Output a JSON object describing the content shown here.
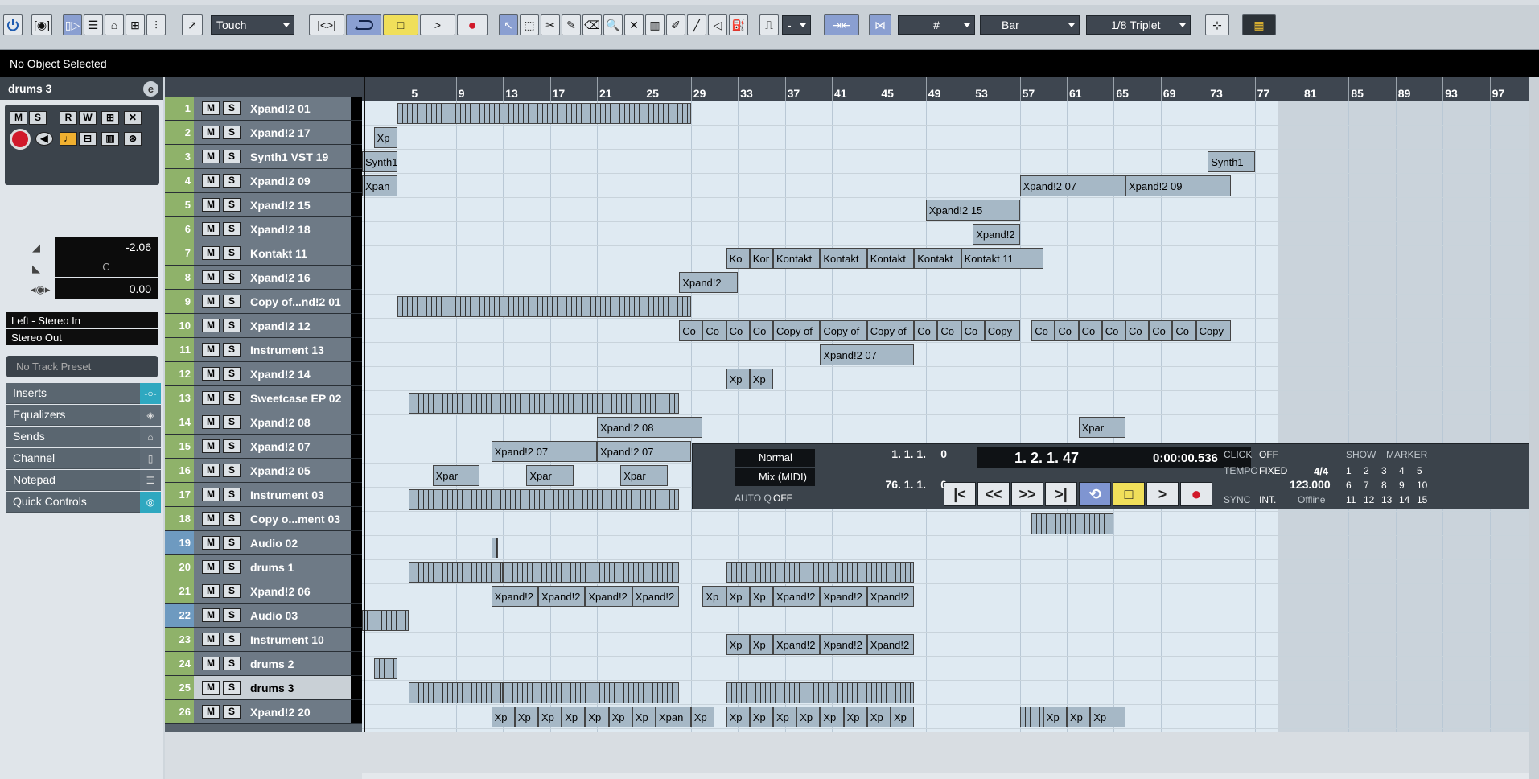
{
  "toolbar": {
    "automation_mode": "Touch",
    "grid_type": "Bar",
    "quantize": "1/8 Triplet",
    "nudge_value": "-"
  },
  "info_line": {
    "text": "No Object Selected"
  },
  "inspector": {
    "track_name": "drums 3",
    "edit_icon": "e",
    "volume": "-2.06",
    "pan": "C",
    "delay": "0.00",
    "input": "Left - Stereo In",
    "output": "Stereo Out",
    "preset": "No Track Preset",
    "sections": [
      "Inserts",
      "Equalizers",
      "Sends",
      "Channel",
      "Notepad",
      "Quick Controls"
    ]
  },
  "ruler": {
    "bars": [
      "5",
      "9",
      "13",
      "17",
      "21",
      "25",
      "29",
      "33",
      "37",
      "41",
      "45",
      "49",
      "53",
      "57",
      "61",
      "65",
      "69",
      "73",
      "77",
      "81",
      "85",
      "89",
      "93",
      "97"
    ]
  },
  "tracks": [
    {
      "num": "1",
      "name": "Xpand!2 01"
    },
    {
      "num": "2",
      "name": "Xpand!2 17"
    },
    {
      "num": "3",
      "name": "Synth1 VST 19"
    },
    {
      "num": "4",
      "name": "Xpand!2 09"
    },
    {
      "num": "5",
      "name": "Xpand!2 15"
    },
    {
      "num": "6",
      "name": "Xpand!2 18"
    },
    {
      "num": "7",
      "name": "Kontakt 11"
    },
    {
      "num": "8",
      "name": "Xpand!2 16"
    },
    {
      "num": "9",
      "name": "Copy of...nd!2 01"
    },
    {
      "num": "10",
      "name": "Xpand!2 12"
    },
    {
      "num": "11",
      "name": "Instrument 13"
    },
    {
      "num": "12",
      "name": "Xpand!2 14"
    },
    {
      "num": "13",
      "name": "Sweetcase EP 02"
    },
    {
      "num": "14",
      "name": "Xpand!2 08"
    },
    {
      "num": "15",
      "name": "Xpand!2 07"
    },
    {
      "num": "16",
      "name": "Xpand!2 05"
    },
    {
      "num": "17",
      "name": "Instrument 03"
    },
    {
      "num": "18",
      "name": "Copy o...ment 03"
    },
    {
      "num": "19",
      "name": "Audio 02"
    },
    {
      "num": "20",
      "name": "drums 1"
    },
    {
      "num": "21",
      "name": "Xpand!2 06"
    },
    {
      "num": "22",
      "name": "Audio 03"
    },
    {
      "num": "23",
      "name": "Instrument 10"
    },
    {
      "num": "24",
      "name": "drums 2"
    },
    {
      "num": "25",
      "name": "drums 3"
    },
    {
      "num": "26",
      "name": "Xpand!2 20"
    }
  ],
  "events": {
    "e0": "Xp",
    "e1": "Synth1",
    "e2": "Synth1",
    "e3": "Xpan",
    "e4": "Xpand!2 07",
    "e5": "Xpand!2 09",
    "e6": "Xpand!2 15",
    "e7": "Xpand!2",
    "e8": "Ko",
    "e9": "Kor",
    "e10": "Kontakt",
    "e11": "Kontakt",
    "e12": "Kontakt",
    "e13": "Kontakt",
    "e14": "Kontakt 11",
    "e15": "Xpand!2",
    "e16": "Co",
    "e17": "Co",
    "e18": "Co",
    "e19": "Co",
    "e20": "Copy of",
    "e21": "Copy of",
    "e22": "Copy of",
    "e23": "Co",
    "e24": "Co",
    "e25": "Co",
    "e26": "Copy",
    "e27": "Co",
    "e28": "Co",
    "e29": "Co",
    "e30": "Co",
    "e31": "Co",
    "e32": "Co",
    "e33": "Co",
    "e34": "Copy",
    "e35": "Xpand!2 07",
    "e36": "Xp",
    "e37": "Xp",
    "e38": "Xpand!2 08",
    "e39": "Xpar",
    "e40": "Xpand!2 07",
    "e41": "Xpand!2 07",
    "e42": "Xpar",
    "e43": "Xpar",
    "e44": "Xpar",
    "e45": "Xpand!2",
    "e46": "Xpand!2",
    "e47": "Xpand!2",
    "e48": "Xpand!2",
    "e49": "Xp",
    "e50": "Xp",
    "e51": "Xp",
    "e52": "Xpand!2",
    "e53": "Xpand!2",
    "e54": "Xpand!2",
    "e55": "Xp",
    "e56": "Xp",
    "e57": "Xpand!2",
    "e58": "Xpand!2",
    "e59": "Xpand!2",
    "e60": "Xp",
    "e61": "Xp",
    "e62": "Xp",
    "e63": "Xp",
    "e64": "Xp",
    "e65": "Xp",
    "e66": "Xp",
    "e67": "Xpan",
    "e68": "Xp",
    "e69": "Xp",
    "e70": "Xp",
    "e71": "Xp",
    "e72": "Xp",
    "e73": "Xp",
    "e74": "Xp",
    "e75": "Xp",
    "e76": "Xp",
    "e77": "Xp",
    "e78": "Xp",
    "e79": "Xp"
  },
  "transport": {
    "mode": "Normal",
    "mix": "Mix (MIDI)",
    "autoq_label": "AUTO Q",
    "autoq": "OFF",
    "left_locator": "1. 1. 1.",
    "left_sub": "0",
    "right_locator": "76. 1. 1.",
    "right_sub": "0",
    "position_bars": "1. 2. 1. 47",
    "position_time": "0:00:00.536",
    "click_label": "CLICK",
    "click": "OFF",
    "tempo_label": "TEMPO",
    "tempo_mode": "FIXED",
    "signature": "4/4",
    "tempo": "123.000",
    "sync_label": "SYNC",
    "sync_mode": "INT.",
    "sync_status": "Offline",
    "show_label": "SHOW",
    "marker_label": "MARKER",
    "markers": [
      "1",
      "2",
      "3",
      "4",
      "5",
      "6",
      "7",
      "8",
      "9",
      "10",
      "11",
      "12",
      "13",
      "14",
      "15"
    ]
  },
  "colors": {
    "midi_track": "#8fb26a",
    "audio_track": "#6e9ac0",
    "event": "#a6b8c6",
    "loop_active": "#7f95d1",
    "stop_active": "#f0df5a",
    "record": "#d1192a"
  }
}
